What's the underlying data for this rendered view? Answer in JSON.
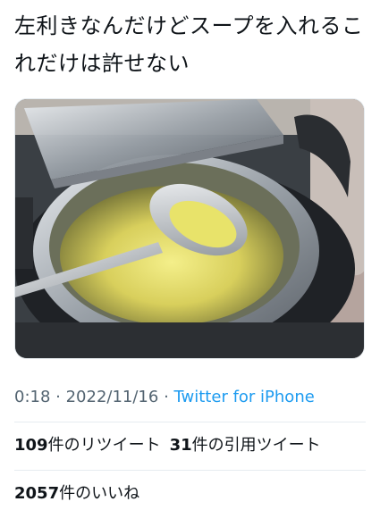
{
  "tweet": {
    "text": "左利きなんだけどスープを入れるこれだけは許せない"
  },
  "media": {
    "icon": "photo",
    "subject": "ladle-in-soup-warmer"
  },
  "meta": {
    "time": "0:18",
    "separator1": " · ",
    "date": "2022/11/16",
    "separator2": " · ",
    "source": "Twitter for iPhone"
  },
  "stats": {
    "retweets_count": "109",
    "retweets_label": "件のリツイート",
    "quotes_count": "31",
    "quotes_label": "件の引用ツイート",
    "likes_count": "2057",
    "likes_label": "件のいいね"
  },
  "colors": {
    "link": "#1d9bf0",
    "muted": "#536471",
    "text": "#0f1419",
    "divider": "#e6ecf0"
  }
}
